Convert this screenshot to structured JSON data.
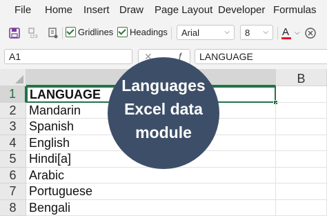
{
  "menu": [
    "File",
    "Home",
    "Insert",
    "Draw",
    "Page Layout",
    "Developer",
    "Formulas"
  ],
  "toolbar": {
    "gridlines_label": "Gridlines",
    "headings_label": "Headings",
    "font_name": "Arial",
    "font_size": "8",
    "font_color": "#e81123"
  },
  "formula_bar": {
    "name_box": "A1",
    "formula": "LANGUAGE"
  },
  "columns": [
    "",
    "B"
  ],
  "rows": [
    "1",
    "2",
    "3",
    "4",
    "5",
    "6",
    "7",
    "8"
  ],
  "cells": [
    "LANGUAGE",
    "Mandarin",
    "Spanish",
    "English",
    "Hindi[a]",
    "Arabic",
    "Portuguese",
    "Bengali"
  ],
  "badge": {
    "line1": "Languages",
    "line2": "Excel data",
    "line3": "module",
    "color": "#3d4f68"
  }
}
